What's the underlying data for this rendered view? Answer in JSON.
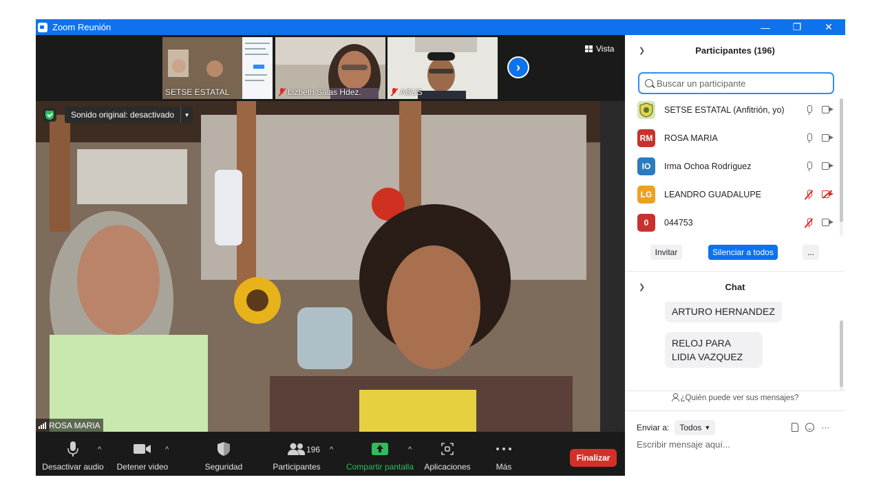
{
  "window": {
    "title": "Zoom Reunión",
    "controls": {
      "minimize": "—",
      "restore": "❐",
      "close": "✕"
    }
  },
  "gallery": {
    "thumbnails": [
      {
        "name": "SETSE ESTATAL",
        "muted": false
      },
      {
        "name": "Lizbeth Salas Hdez.",
        "muted": true
      },
      {
        "name": "ASUS",
        "muted": true
      }
    ],
    "next_label": "›",
    "view_label": "Vista"
  },
  "main_video": {
    "sound_label": "Sonido original: desactivado",
    "speaker": "ROSA MARIA"
  },
  "toolbar": {
    "mute_label": "Desactivar audio",
    "video_label": "Detener video",
    "security_label": "Seguridad",
    "participants_label": "Participantes",
    "participants_count": "196",
    "share_label": "Compartir pantalla",
    "apps_label": "Aplicaciones",
    "more_label": "Más",
    "end_label": "Finalizar"
  },
  "participants": {
    "header": "Participantes (196)",
    "search_placeholder": "Buscar un participante",
    "list": [
      {
        "initials": "",
        "name": "SETSE ESTATAL (Anfitrión, yo)",
        "color": "#d8e6b0",
        "mic_off": false,
        "cam_off": false
      },
      {
        "initials": "RM",
        "name": "ROSA MARIA",
        "color": "#c8322d",
        "mic_off": false,
        "cam_off": false
      },
      {
        "initials": "IO",
        "name": "Irma Ochoa Rodríguez",
        "color": "#2b7bbf",
        "mic_off": false,
        "cam_off": false
      },
      {
        "initials": "LG",
        "name": " LEANDRO GUADALUPE",
        "color": "#f0a020",
        "mic_off": true,
        "cam_off": true
      },
      {
        "initials": "0",
        "name": "044753",
        "color": "#c8322d",
        "mic_off": true,
        "cam_off": false
      }
    ],
    "invite_label": "Invitar",
    "mute_all_label": "Silenciar a todos",
    "more_label": "..."
  },
  "chat": {
    "header": "Chat",
    "messages": [
      {
        "text": "ARTURO HERNANDEZ"
      },
      {
        "text": "RELOJ PARA LIDIA VAZQUEZ"
      }
    ],
    "visibility_note": "¿Quién puede ver sus mensajes?",
    "send_to_label": "Enviar a:",
    "send_to_value": "Todos",
    "input_placeholder": "Escribir mensaje aquí...",
    "more_label": "···"
  },
  "colors": {
    "zoom_blue": "#0e72ed",
    "end_red": "#d4302a",
    "share_green": "#2ebd59"
  }
}
